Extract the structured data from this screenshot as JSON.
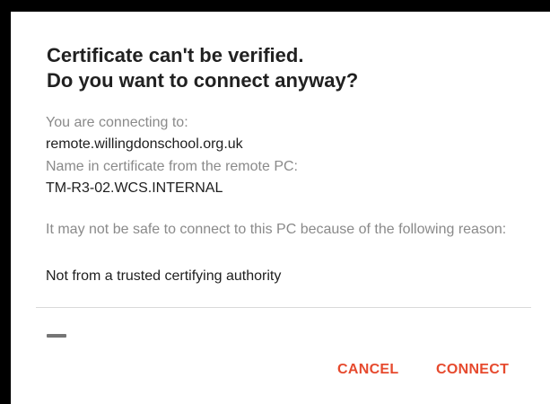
{
  "dialog": {
    "title": "Certificate can't be verified.\nDo you want to connect anyway?",
    "connecting_label": "You are connecting to:",
    "connecting_value": "remote.willingdonschool.org.uk",
    "cert_name_label": "Name in certificate from the remote PC:",
    "cert_name_value": "TM-R3-02.WCS.INTERNAL",
    "reason_label": "It may not be safe to connect to this PC because of the following reason:",
    "reason_value": "Not from a trusted certifying authority",
    "cancel_label": "CANCEL",
    "connect_label": "CONNECT"
  },
  "colors": {
    "accent": "#e64a2e",
    "label_gray": "#8a8a8a",
    "text": "#1e1e1e",
    "backdrop": "#000000"
  }
}
